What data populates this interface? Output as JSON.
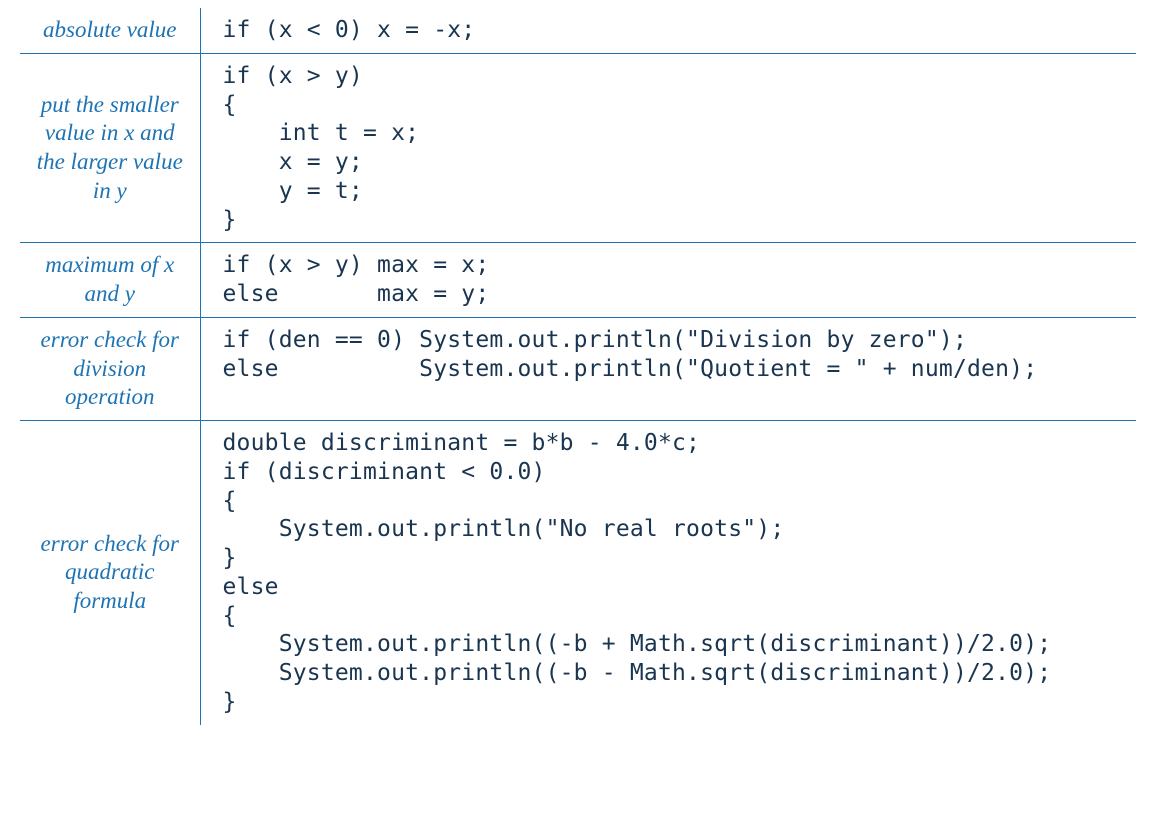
{
  "rows": [
    {
      "desc": "absolute value",
      "code": "if (x < 0) x = -x;"
    },
    {
      "desc": "put the smaller\nvalue in x\nand the larger\nvalue in y",
      "code": "if (x > y)\n{\n    int t = x;\n    x = y;\n    y = t;\n}"
    },
    {
      "desc": "maximum of\nx and y",
      "code": "if (x > y) max = x;\nelse       max = y;"
    },
    {
      "desc": "error check\nfor division\noperation",
      "code": "if (den == 0) System.out.println(\"Division by zero\");\nelse          System.out.println(\"Quotient = \" + num/den);"
    },
    {
      "desc": "error check\nfor quadratic\nformula",
      "code": "double discriminant = b*b - 4.0*c;\nif (discriminant < 0.0)\n{\n    System.out.println(\"No real roots\");\n}\nelse\n{\n    System.out.println((-b + Math.sqrt(discriminant))/2.0);\n    System.out.println((-b - Math.sqrt(discriminant))/2.0);\n}"
    }
  ]
}
